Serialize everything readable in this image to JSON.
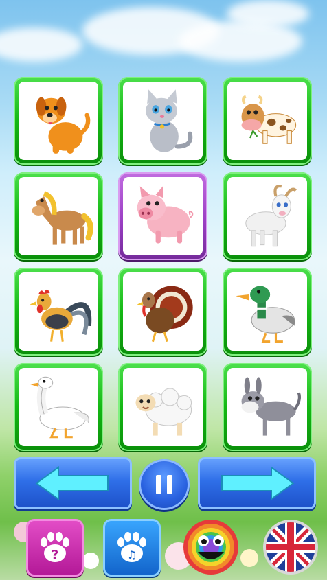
{
  "screen": "animal-sounds-grid",
  "grid": {
    "cards": [
      {
        "animal": "dog",
        "icon": "dog-icon",
        "selected": false
      },
      {
        "animal": "cat",
        "icon": "cat-icon",
        "selected": false
      },
      {
        "animal": "cow",
        "icon": "cow-icon",
        "selected": false
      },
      {
        "animal": "horse",
        "icon": "horse-icon",
        "selected": false
      },
      {
        "animal": "pig",
        "icon": "pig-icon",
        "selected": true
      },
      {
        "animal": "goat",
        "icon": "goat-icon",
        "selected": false
      },
      {
        "animal": "rooster",
        "icon": "rooster-icon",
        "selected": false
      },
      {
        "animal": "turkey",
        "icon": "turkey-icon",
        "selected": false
      },
      {
        "animal": "duck",
        "icon": "duck-icon",
        "selected": false
      },
      {
        "animal": "goose",
        "icon": "goose-icon",
        "selected": false
      },
      {
        "animal": "sheep",
        "icon": "sheep-icon",
        "selected": false
      },
      {
        "animal": "donkey",
        "icon": "donkey-icon",
        "selected": false
      }
    ]
  },
  "controls": {
    "prev_icon": "arrow-left-icon",
    "pause_icon": "pause-icon",
    "next_icon": "arrow-right-icon"
  },
  "bottom_bar": {
    "quiz_icon": "paw-question-icon",
    "sounds_icon": "paw-music-icon",
    "smile_icon": "rainbow-smiley-icon",
    "language_icon": "uk-flag-icon"
  },
  "colors": {
    "card_green": "#14b814",
    "card_selected_purple": "#9b3fc4",
    "nav_blue": "#2f6fe8",
    "quiz_pink": "#b21796",
    "sounds_blue": "#1162c9"
  }
}
